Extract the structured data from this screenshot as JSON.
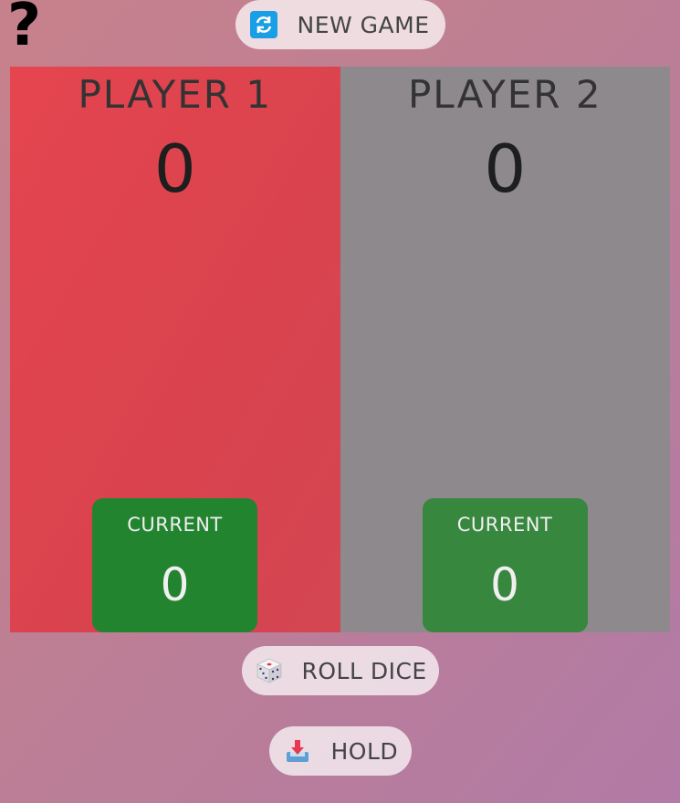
{
  "help": {
    "icon": "question-mark-icon",
    "glyph": "?"
  },
  "buttons": {
    "new_game": {
      "label": "NEW GAME",
      "icon": "refresh-icon"
    },
    "roll_dice": {
      "label": "ROLL DICE",
      "icon": "dice-icon"
    },
    "hold": {
      "label": "HOLD",
      "icon": "inbox-tray-icon"
    }
  },
  "players": [
    {
      "name": "PLAYER 1",
      "score": "0",
      "current_label": "CURRENT",
      "current_score": "0",
      "active": true
    },
    {
      "name": "PLAYER 2",
      "score": "0",
      "current_label": "CURRENT",
      "current_score": "0",
      "active": false
    }
  ],
  "colors": {
    "active_panel": "#e0444f",
    "inactive_panel": "#8e898c",
    "current_box": "#238430",
    "icon_blue": "#1a9ee6"
  }
}
